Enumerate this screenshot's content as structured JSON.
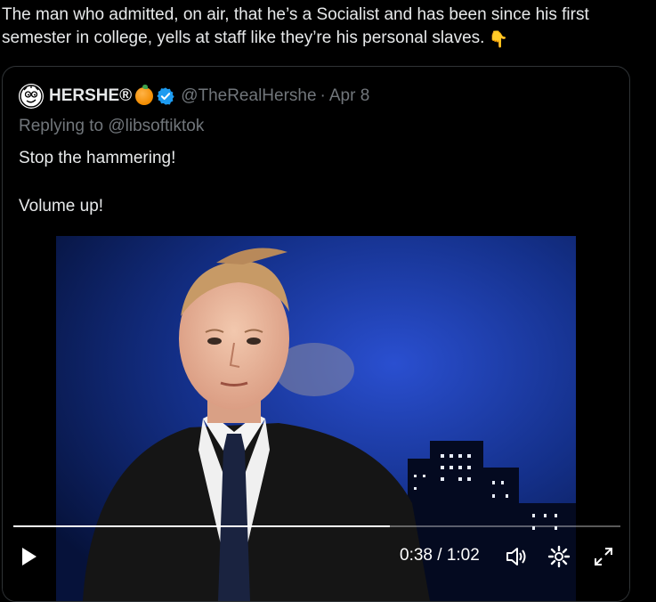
{
  "tweet": {
    "text": "The man who admitted, on air, that he’s a Socialist and has been since his first semester in college, yells at staff like they’re his personal slaves.",
    "emoji": "👇"
  },
  "quote": {
    "display_name": "HERSHE®",
    "handle": "@TheRealHershe",
    "separator": "·",
    "date": "Apr 8",
    "replying_to": "Replying to @libsoftiktok",
    "lines": [
      "Stop the hammering!",
      "Volume up!"
    ]
  },
  "video": {
    "time": "0:38 / 1:02",
    "progress": 0.62,
    "icons": [
      "play-icon",
      "volume-icon",
      "settings-icon",
      "fullscreen-icon"
    ]
  },
  "colors": {
    "background": "#000000",
    "text": "#e7e9ea",
    "muted": "#71767b",
    "border": "#2f3336",
    "verified": "#1d9bf0"
  }
}
